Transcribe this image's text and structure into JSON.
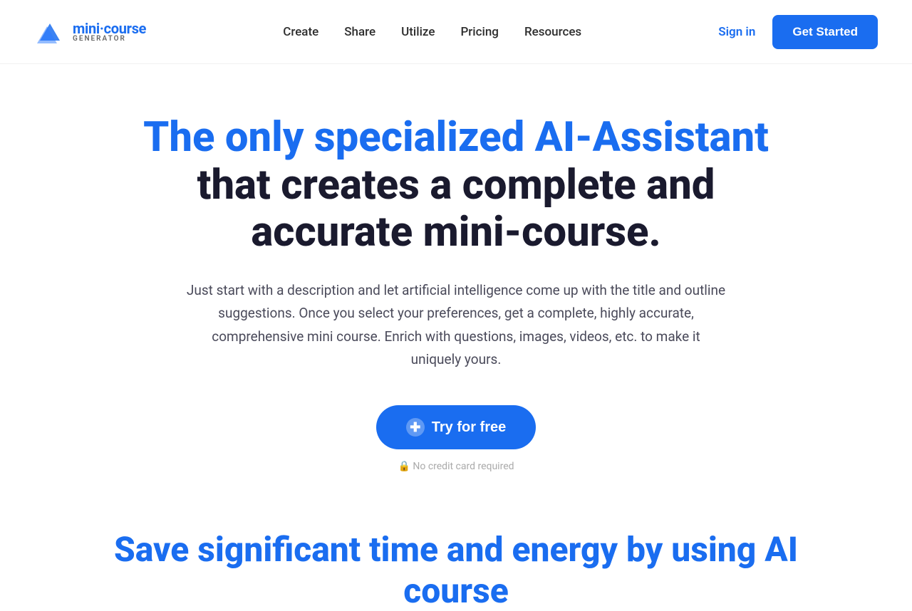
{
  "header": {
    "logo": {
      "name_part1": "mini",
      "dot": "·",
      "name_part2": "course",
      "sub": "GENERATOR"
    },
    "nav": {
      "items": [
        {
          "label": "Create",
          "id": "create"
        },
        {
          "label": "Share",
          "id": "share"
        },
        {
          "label": "Utilize",
          "id": "utilize"
        },
        {
          "label": "Pricing",
          "id": "pricing"
        },
        {
          "label": "Resources",
          "id": "resources"
        }
      ]
    },
    "actions": {
      "sign_in": "Sign in",
      "get_started": "Get Started"
    }
  },
  "hero": {
    "heading_blue": "The only specialized AI-Assistant",
    "heading_dark": " that creates a complete and accurate mini-course.",
    "subtext": "Just start with a description and let artificial intelligence come up with the title and outline suggestions. Once you select your preferences, get a complete, highly accurate, comprehensive mini course. Enrich with questions, images, videos, etc. to make it uniquely yours.",
    "cta_button": "Try for free",
    "cta_icon": "+",
    "no_credit_card": "🔒 No credit card required"
  },
  "save_section": {
    "heading_part1": "Save significant time and energy by using AI course"
  },
  "colors": {
    "brand_blue": "#1a6df0",
    "heading_dark": "#1a1a2e",
    "text_gray": "#4a4a5a"
  }
}
